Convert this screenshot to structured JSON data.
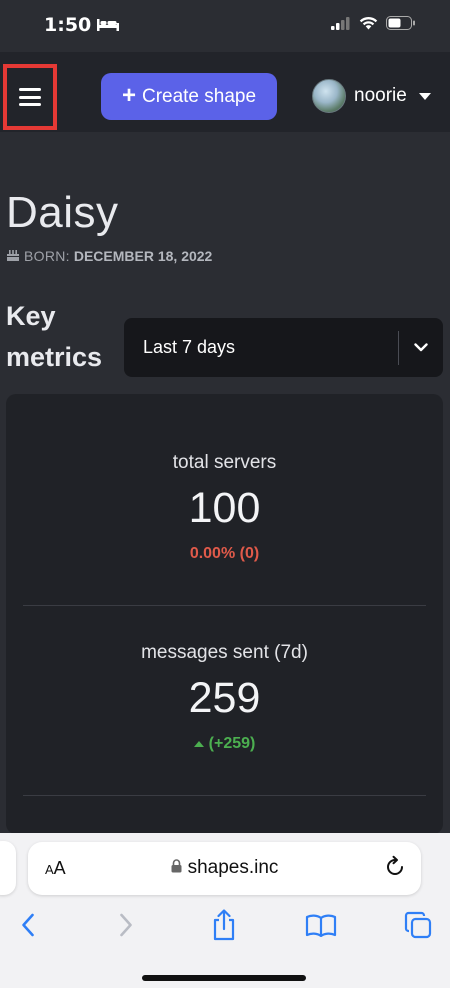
{
  "status_bar": {
    "time": "1:50",
    "icons": [
      "bed-icon",
      "signal-icon",
      "wifi-icon",
      "battery-icon"
    ]
  },
  "nav": {
    "menu_icon": "hamburger-icon",
    "create_label": "Create shape",
    "username": "noorie"
  },
  "profile": {
    "name": "Daisy",
    "born_label": "BORN:",
    "born_date": "DECEMBER 18, 2022"
  },
  "metrics_header": {
    "title_line1": "Key",
    "title_line2": "metrics",
    "range_selected": "Last 7 days"
  },
  "metrics": [
    {
      "label": "total servers",
      "value": "100",
      "change": "0.00% (0)",
      "trend": "neutral-negative"
    },
    {
      "label": "messages sent (7d)",
      "value": "259",
      "change": "(+259)",
      "trend": "up"
    }
  ],
  "browser": {
    "text_size_label": "AA",
    "url": "shapes.inc",
    "toolbar_icons": [
      "back-icon",
      "forward-icon",
      "share-icon",
      "bookmarks-icon",
      "tabs-icon"
    ]
  },
  "colors": {
    "background": "#2b2d33",
    "nav_background": "#22242a",
    "accent": "#5b62e8",
    "highlight_border": "#e53935",
    "negative": "#e05a4a",
    "positive": "#4caf50",
    "ios_blue": "#2f7ff6"
  }
}
